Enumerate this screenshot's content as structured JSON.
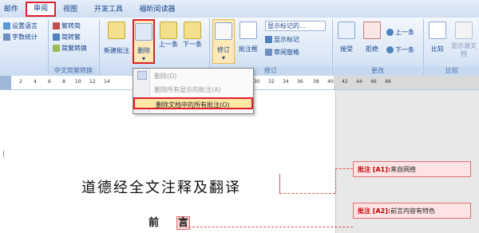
{
  "tabs": [
    "邮件",
    "审阅",
    "视图",
    "开发工具",
    "福昕阅读器"
  ],
  "ribbon": {
    "proofing": {
      "set_language": "设置语言",
      "word_count": "字数统计"
    },
    "chinese": {
      "to_trad": "繁转简",
      "to_simp": "简转繁",
      "convert": "简繁转换",
      "group": "中文简繁转换"
    },
    "comments": {
      "new": "新建批注",
      "delete": "删除",
      "prev": "上一条",
      "next": "下一条"
    },
    "tracking": {
      "track": "修订",
      "balloons": "批注框",
      "show_markup": "显示标记的...",
      "show_markup2": "显示标记",
      "review_pane": "审阅窗格",
      "group": "修订"
    },
    "changes": {
      "accept": "接受",
      "reject": "拒绝",
      "prev": "上一条",
      "next": "下一条",
      "group": "更改"
    },
    "compare": {
      "compare": "比较",
      "show_source": "显示源文档",
      "group": "比较"
    }
  },
  "menu": {
    "items": [
      "删除(D)",
      "删除所有显示的批注(A)",
      "删除文档中的所有批注(O)"
    ]
  },
  "ruler": {
    "ticks": [
      "2",
      "4",
      "6",
      "8",
      "10",
      "12",
      "14",
      "30",
      "32",
      "34",
      "36",
      "38",
      "40",
      "42",
      "44",
      "46",
      "48"
    ]
  },
  "document": {
    "title": "道德经全文注释及翻译",
    "subtitle_a": "前",
    "subtitle_b": "言"
  },
  "comments": [
    {
      "tag": "批注 [A1]:",
      "text": "来自网络"
    },
    {
      "tag": "批注 [A2]:",
      "text": "前言内容有特色"
    }
  ],
  "colors": {
    "accent": "#e0202a",
    "ribbon": "#dde9f7",
    "comment_fill": "#fde3e3"
  }
}
